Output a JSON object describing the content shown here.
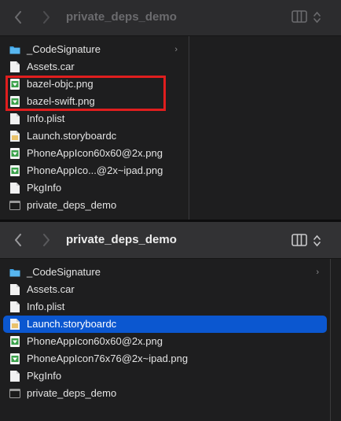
{
  "top_window": {
    "title": "private_deps_demo",
    "files": [
      {
        "name": "_CodeSignature",
        "icon": "folder-icon",
        "chevron": "›"
      },
      {
        "name": "Assets.car",
        "icon": "document-icon"
      },
      {
        "name": "bazel-objc.png",
        "icon": "png-image-icon"
      },
      {
        "name": "bazel-swift.png",
        "icon": "png-image-icon"
      },
      {
        "name": "Info.plist",
        "icon": "document-icon"
      },
      {
        "name": "Launch.storyboardc",
        "icon": "storyboard-icon"
      },
      {
        "name": "PhoneAppIcon60x60@2x.png",
        "icon": "png-image-icon"
      },
      {
        "name": "PhoneAppIco...@2x~ipad.png",
        "icon": "png-image-icon"
      },
      {
        "name": "PkgInfo",
        "icon": "document-icon"
      },
      {
        "name": "private_deps_demo",
        "icon": "executable-icon"
      }
    ]
  },
  "bottom_window": {
    "title": "private_deps_demo",
    "files": [
      {
        "name": "_CodeSignature",
        "icon": "folder-icon",
        "chevron": "›"
      },
      {
        "name": "Assets.car",
        "icon": "document-icon"
      },
      {
        "name": "Info.plist",
        "icon": "document-icon"
      },
      {
        "name": "Launch.storyboardc",
        "icon": "storyboard-icon",
        "selected": true
      },
      {
        "name": "PhoneAppIcon60x60@2x.png",
        "icon": "png-image-icon"
      },
      {
        "name": "PhoneAppIcon76x76@2x~ipad.png",
        "icon": "png-image-icon"
      },
      {
        "name": "PkgInfo",
        "icon": "document-icon"
      },
      {
        "name": "private_deps_demo",
        "icon": "executable-icon"
      }
    ]
  },
  "colors": {
    "selection": "#0b57d0",
    "highlight_box": "#e01e1e",
    "folder": "#3fa3e6",
    "png_green": "#3aa14a"
  }
}
